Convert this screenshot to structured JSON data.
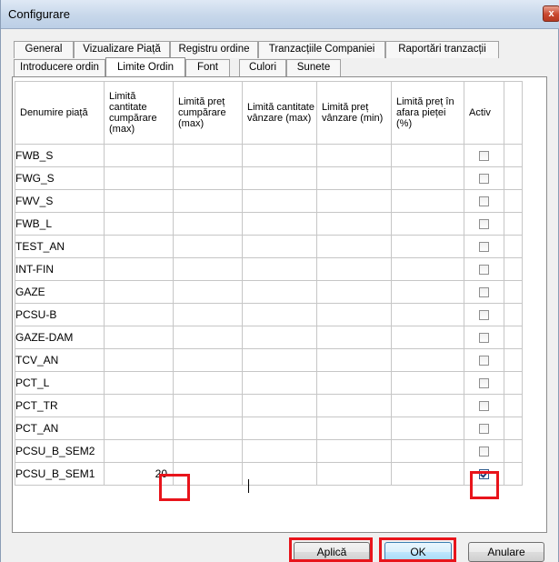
{
  "window": {
    "title": "Configurare",
    "close_glyph": "x"
  },
  "tabs_row1": [
    "General",
    "Vizualizare Piață",
    "Registru ordine",
    "Tranzacțiile Companiei",
    "Raportări tranzacții"
  ],
  "tabs_row2": [
    "Introducere ordin",
    "Limite Ordin",
    "Font",
    "Culori",
    "Sunete"
  ],
  "active_tab": "Limite Ordin",
  "columns": [
    "Denumire piață",
    "Limită cantitate cumpărare (max)",
    "Limită preț cumpărare (max)",
    "Limită cantitate vânzare (max)",
    "Limită preț vânzare (min)",
    "Limită preț în afara pieței (%)",
    "Activ"
  ],
  "rows": [
    {
      "name": "FWB_S",
      "buy_qty": "",
      "buy_price": "",
      "sell_qty": "",
      "sell_price": "",
      "out_of_market": "",
      "active": false
    },
    {
      "name": "FWG_S",
      "buy_qty": "",
      "buy_price": "",
      "sell_qty": "",
      "sell_price": "",
      "out_of_market": "",
      "active": false
    },
    {
      "name": "FWV_S",
      "buy_qty": "",
      "buy_price": "",
      "sell_qty": "",
      "sell_price": "",
      "out_of_market": "",
      "active": false
    },
    {
      "name": "FWB_L",
      "buy_qty": "",
      "buy_price": "",
      "sell_qty": "",
      "sell_price": "",
      "out_of_market": "",
      "active": false
    },
    {
      "name": "TEST_AN",
      "buy_qty": "",
      "buy_price": "",
      "sell_qty": "",
      "sell_price": "",
      "out_of_market": "",
      "active": false
    },
    {
      "name": "INT-FIN",
      "buy_qty": "",
      "buy_price": "",
      "sell_qty": "",
      "sell_price": "",
      "out_of_market": "",
      "active": false
    },
    {
      "name": "GAZE",
      "buy_qty": "",
      "buy_price": "",
      "sell_qty": "",
      "sell_price": "",
      "out_of_market": "",
      "active": false
    },
    {
      "name": "PCSU-B",
      "buy_qty": "",
      "buy_price": "",
      "sell_qty": "",
      "sell_price": "",
      "out_of_market": "",
      "active": false
    },
    {
      "name": "GAZE-DAM",
      "buy_qty": "",
      "buy_price": "",
      "sell_qty": "",
      "sell_price": "",
      "out_of_market": "",
      "active": false
    },
    {
      "name": "TCV_AN",
      "buy_qty": "",
      "buy_price": "",
      "sell_qty": "",
      "sell_price": "",
      "out_of_market": "",
      "active": false
    },
    {
      "name": "PCT_L",
      "buy_qty": "",
      "buy_price": "",
      "sell_qty": "",
      "sell_price": "",
      "out_of_market": "",
      "active": false
    },
    {
      "name": "PCT_TR",
      "buy_qty": "",
      "buy_price": "",
      "sell_qty": "",
      "sell_price": "",
      "out_of_market": "",
      "active": false
    },
    {
      "name": "PCT_AN",
      "buy_qty": "",
      "buy_price": "",
      "sell_qty": "",
      "sell_price": "",
      "out_of_market": "",
      "active": false
    },
    {
      "name": "PCSU_B_SEM2",
      "buy_qty": "",
      "buy_price": "",
      "sell_qty": "",
      "sell_price": "",
      "out_of_market": "",
      "active": false
    },
    {
      "name": "PCSU_B_SEM1",
      "buy_qty": "20",
      "buy_price": "",
      "sell_qty": "",
      "sell_price": "",
      "out_of_market": "",
      "active": true
    }
  ],
  "buttons": {
    "apply": "Aplică",
    "ok": "OK",
    "cancel": "Anulare"
  },
  "colors": {
    "highlight": "#e8141b",
    "titlebar": "#c7d7ea",
    "checkbox_checked": "#1f3f77"
  }
}
